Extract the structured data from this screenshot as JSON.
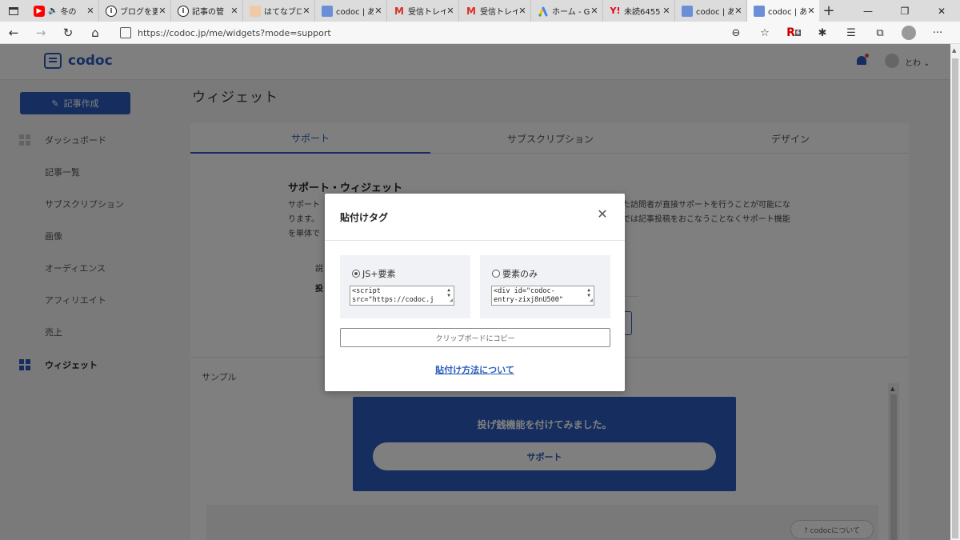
{
  "browser": {
    "tabs": [
      {
        "label": "冬の",
        "favicon": "youtube",
        "active": false
      },
      {
        "label": "ブログを更",
        "favicon": "info",
        "active": false
      },
      {
        "label": "記事の管",
        "favicon": "info",
        "active": false
      },
      {
        "label": "はてなブロ",
        "favicon": "hatena",
        "active": false
      },
      {
        "label": "codoc | あ",
        "favicon": "codoc",
        "active": false
      },
      {
        "label": "受信トレイ",
        "favicon": "gmail",
        "active": false
      },
      {
        "label": "受信トレイ",
        "favicon": "gmail",
        "active": false
      },
      {
        "label": "ホーム - G",
        "favicon": "google-ads",
        "active": false
      },
      {
        "label": "未読6455",
        "favicon": "yahoo",
        "active": false
      },
      {
        "label": "codoc | あ",
        "favicon": "codoc",
        "active": false
      },
      {
        "label": "codoc | あ",
        "favicon": "codoc",
        "active": true
      }
    ],
    "url": "https://codoc.jp/me/widgets?mode=support",
    "ext_badge": "6"
  },
  "app": {
    "logo": "codoc",
    "user_name": "とわ",
    "new_post_label": "記事作成",
    "sidebar": [
      {
        "label": "ダッシュボード",
        "active": false
      },
      {
        "label": "記事一覧",
        "active": false
      },
      {
        "label": "サブスクリプション",
        "active": false
      },
      {
        "label": "画像",
        "active": false
      },
      {
        "label": "オーディエンス",
        "active": false
      },
      {
        "label": "アフィリエイト",
        "active": false
      },
      {
        "label": "売上",
        "active": false
      },
      {
        "label": "ウィジェット",
        "active": true
      }
    ],
    "page_title": "ウィジェット",
    "widget_tabs": [
      {
        "label": "サポート",
        "active": true
      },
      {
        "label": "サブスクリプション",
        "active": false
      },
      {
        "label": "デザイン",
        "active": false
      }
    ],
    "section_title": "サポート・ウィジェット",
    "desc_left": [
      "サポート",
      "ります。",
      "を単体で"
    ],
    "desc_right": [
      "た訪問者が直接サポートを行うことが可能にな",
      "では記事投稿をおこなうことなくサポート機能"
    ],
    "settings_frag1": "説",
    "settings_frag2": "投",
    "sample_label": "サンプル",
    "preview_text": "投げ銭機能を付けてみました。",
    "preview_button": "サポート",
    "about_codoc": "? codocについて"
  },
  "modal": {
    "title": "貼付けタグ",
    "option_js": "JS+要素",
    "option_element": "要素のみ",
    "selected": "JS+要素",
    "code_js": "<script\nsrc=\"https://codoc.j",
    "code_element": "<div id=\"codoc-\nentry-zixj8nU500\"",
    "copy_button": "クリップボードにコピー",
    "howto_link": "貼付け方法について"
  }
}
